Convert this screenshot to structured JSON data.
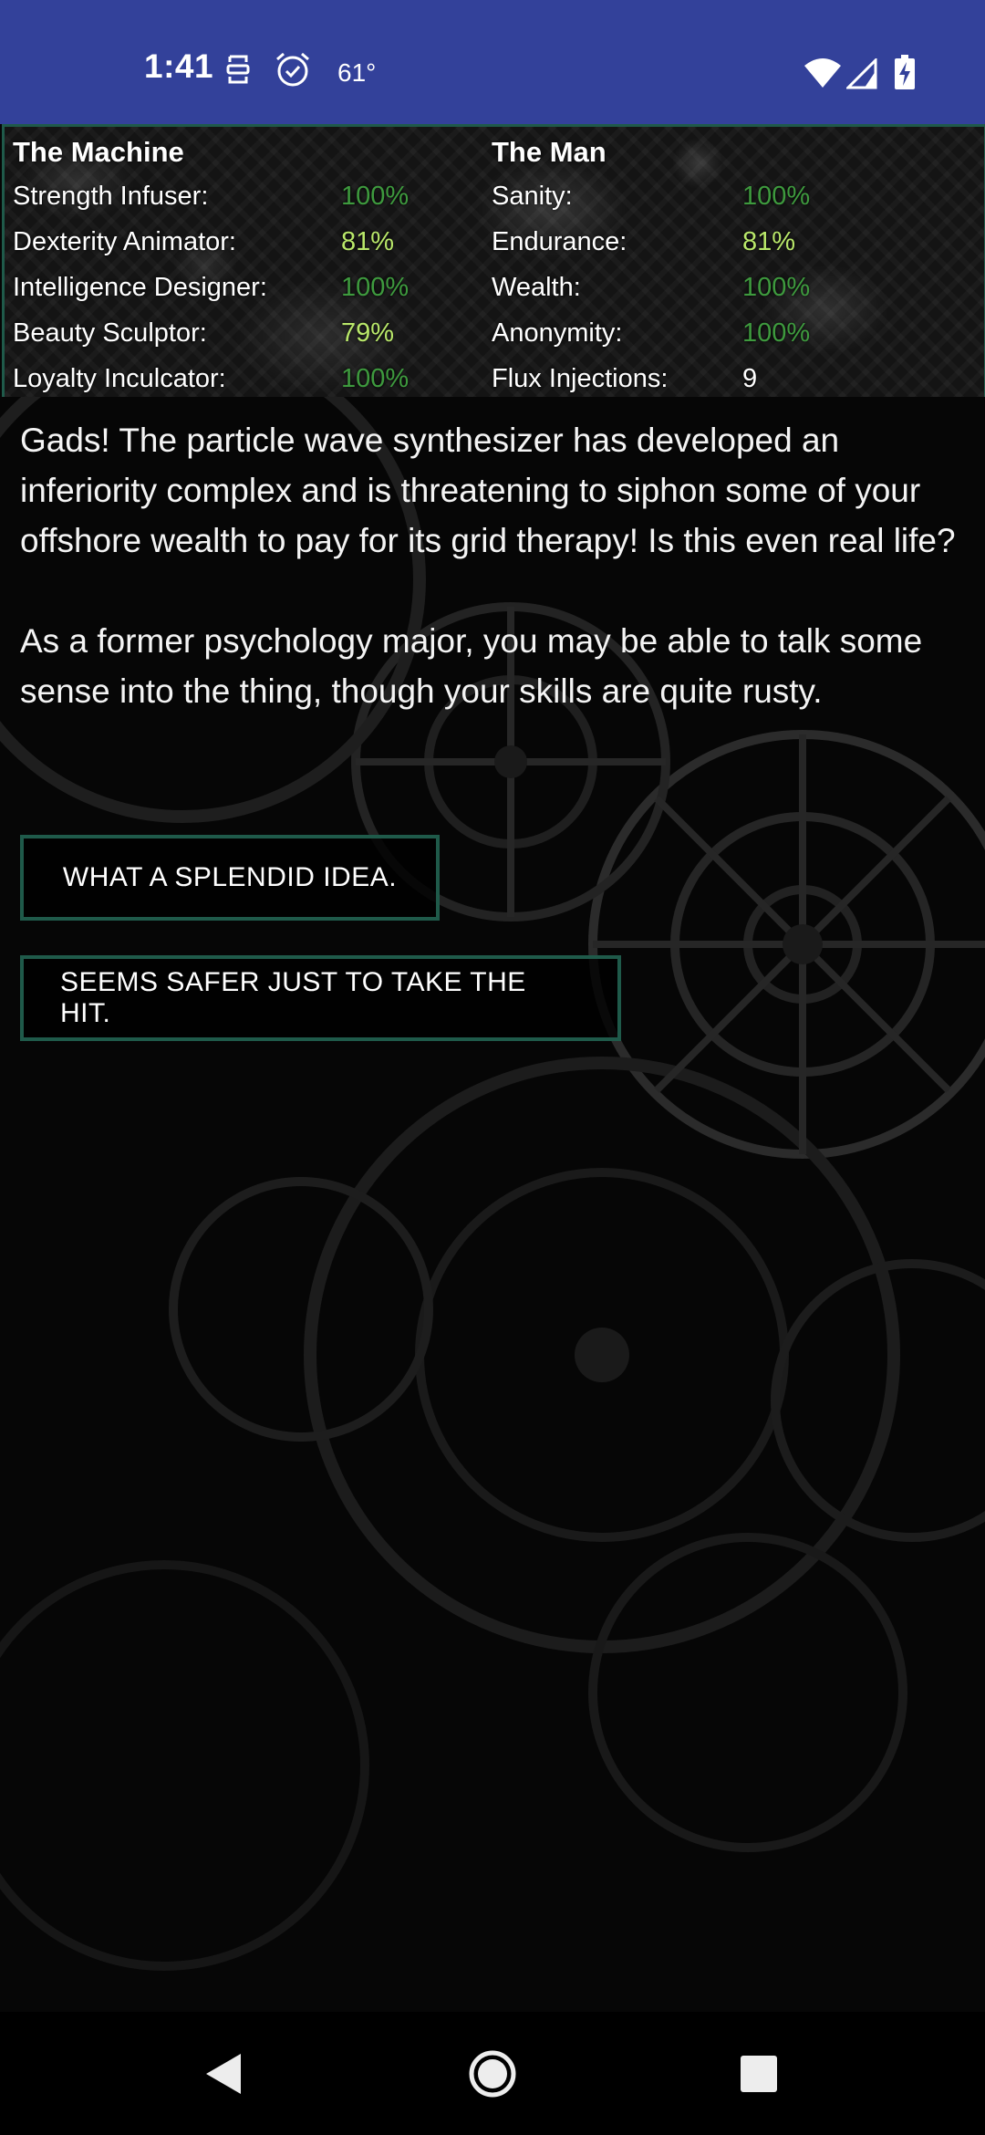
{
  "status_bar": {
    "time": "1:41",
    "temperature": "61°",
    "icons": [
      "face-id-icon",
      "alarm-icon",
      "wifi-icon",
      "cell-signal-icon",
      "battery-charging-icon"
    ]
  },
  "stats": {
    "machine": {
      "heading": "The Machine",
      "items": [
        {
          "label": "Strength Infuser:",
          "value": "100%",
          "color": "#3e9a3e"
        },
        {
          "label": "Dexterity Animator:",
          "value": "81%",
          "color": "#b9e86a"
        },
        {
          "label": "Intelligence Designer:",
          "value": "100%",
          "color": "#3e9a3e"
        },
        {
          "label": "Beauty Sculptor:",
          "value": "79%",
          "color": "#b9e86a"
        },
        {
          "label": "Loyalty Inculcator:",
          "value": "100%",
          "color": "#3e9a3e"
        }
      ]
    },
    "man": {
      "heading": "The Man",
      "items": [
        {
          "label": "Sanity:",
          "value": "100%",
          "color": "#3e9a3e"
        },
        {
          "label": "Endurance:",
          "value": "81%",
          "color": "#b9e86a"
        },
        {
          "label": "Wealth:",
          "value": "100%",
          "color": "#3e9a3e"
        },
        {
          "label": "Anonymity:",
          "value": "100%",
          "color": "#3e9a3e"
        },
        {
          "label": "Flux Injections:",
          "value": "9",
          "color": "#ffffff"
        }
      ]
    }
  },
  "story": {
    "paragraphs": [
      "Gads! The particle wave synthesizer has developed an inferiority complex and is threatening to siphon some of your offshore wealth to pay for its grid therapy! Is this even real life?",
      "As a former psychology major, you may be able to talk some sense into the thing, though your skills are quite rusty."
    ]
  },
  "choices": [
    {
      "label": "WHAT A SPLENDID IDEA."
    },
    {
      "label": "SEEMS SAFER JUST TO TAKE THE HIT."
    }
  ],
  "colors": {
    "status_bar": "#33419a",
    "panel_border": "#1f5a4a",
    "value_full": "#3e9a3e",
    "value_partial": "#b9e86a"
  },
  "nav": {
    "icons": [
      "back-icon",
      "home-icon",
      "recents-icon"
    ]
  }
}
